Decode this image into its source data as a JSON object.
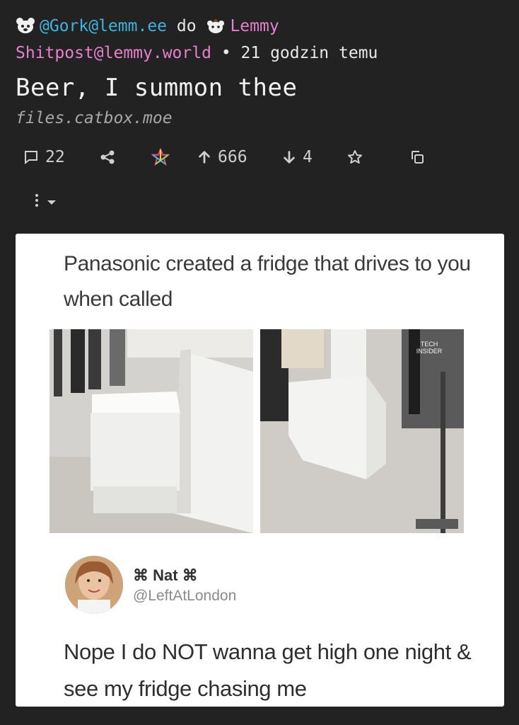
{
  "post": {
    "author": "@Gork@lemm.ee",
    "connector": "do",
    "community_line1": "Lemmy",
    "community_line2": "Shitpost@lemmy.world",
    "separator": "•",
    "time": "21 godzin temu",
    "title": "Beer, I summon thee",
    "domain": "files.catbox.moe"
  },
  "actions": {
    "comments_count": "22",
    "upvotes": "666",
    "downvotes": "4",
    "icons": [
      "comment-icon",
      "share-icon",
      "crosspost-icon",
      "upvote-icon",
      "downvote-icon",
      "star-icon",
      "copy-icon",
      "more-vertical-icon",
      "chevron-down-icon"
    ]
  },
  "image": {
    "caption": "Panasonic created a fridge that drives to you when called",
    "tweet_name": "⌘ Nat ⌘",
    "tweet_handle": "@LeftAtLondon",
    "tweet_text": "Nope I do NOT wanna get high one night & see my fridge chasing me",
    "watermark": "TECH INSIDER"
  },
  "colors": {
    "background": "#222222",
    "user_link": "#3fb3df",
    "community_link": "#e77fcf",
    "text": "#e8e8e8",
    "muted": "#a8a8a8"
  }
}
